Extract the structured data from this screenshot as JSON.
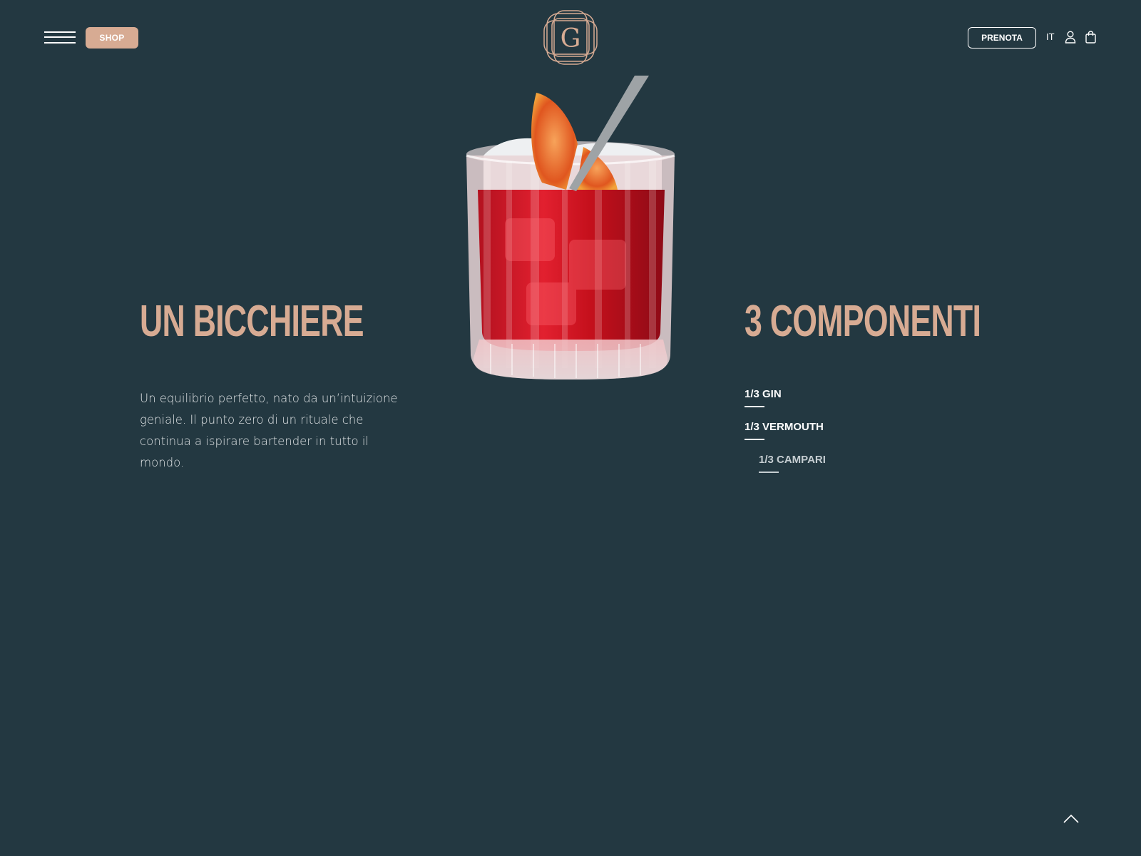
{
  "header": {
    "shop_label": "SHOP",
    "logo_letter": "G",
    "prenota_label": "PRENOTA",
    "language": "IT"
  },
  "left": {
    "title": "UN BICCHIERE",
    "description": "Un equilibrio perfetto, nato da un’intuizione geniale. Il punto zero di un rituale che continua a ispirare bartender in tutto il mondo."
  },
  "right": {
    "title": "3 COMPONENTI",
    "components": [
      "1/3 GIN",
      "1/3 VERMOUTH",
      "1/3 CAMPARI"
    ]
  },
  "colors": {
    "background": "#233841",
    "accent": "#d7ab93",
    "text": "#ffffff",
    "muted": "#c5cdd1"
  },
  "icons": [
    "menu-icon",
    "user-icon",
    "shopping-bag-icon",
    "chevron-up-icon"
  ]
}
